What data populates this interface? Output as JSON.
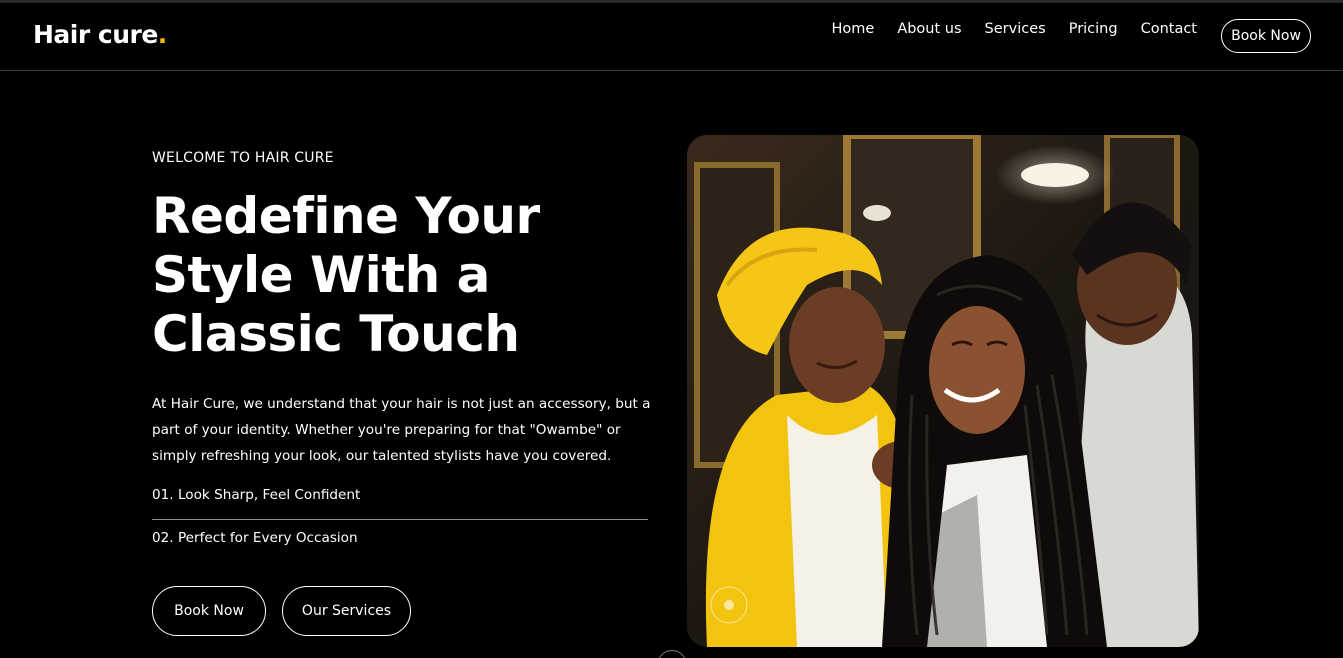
{
  "brand": {
    "name": "Hair cure",
    "dot": ".",
    "accent": "#f2b705"
  },
  "nav": {
    "items": [
      "Home",
      "About us",
      "Services",
      "Pricing",
      "Contact"
    ],
    "cta": "Book Now"
  },
  "hero": {
    "eyebrow": "WELCOME TO HAIR CURE",
    "title": "Redefine Your Style With a Classic Touch",
    "description": "At Hair Cure, we understand that your hair is not just an accessory, but a part of your identity. Whether you're preparing for that \"Owambe\" or simply refreshing your look, our talented stylists have you covered.",
    "features": [
      "01. Look Sharp, Feel Confident",
      "02. Perfect for Every Occasion"
    ],
    "buttons": {
      "primary": "Book Now",
      "secondary": "Our Services"
    }
  },
  "colors": {
    "background": "#000000",
    "text": "#ffffff",
    "yellow": "#f5c518"
  }
}
